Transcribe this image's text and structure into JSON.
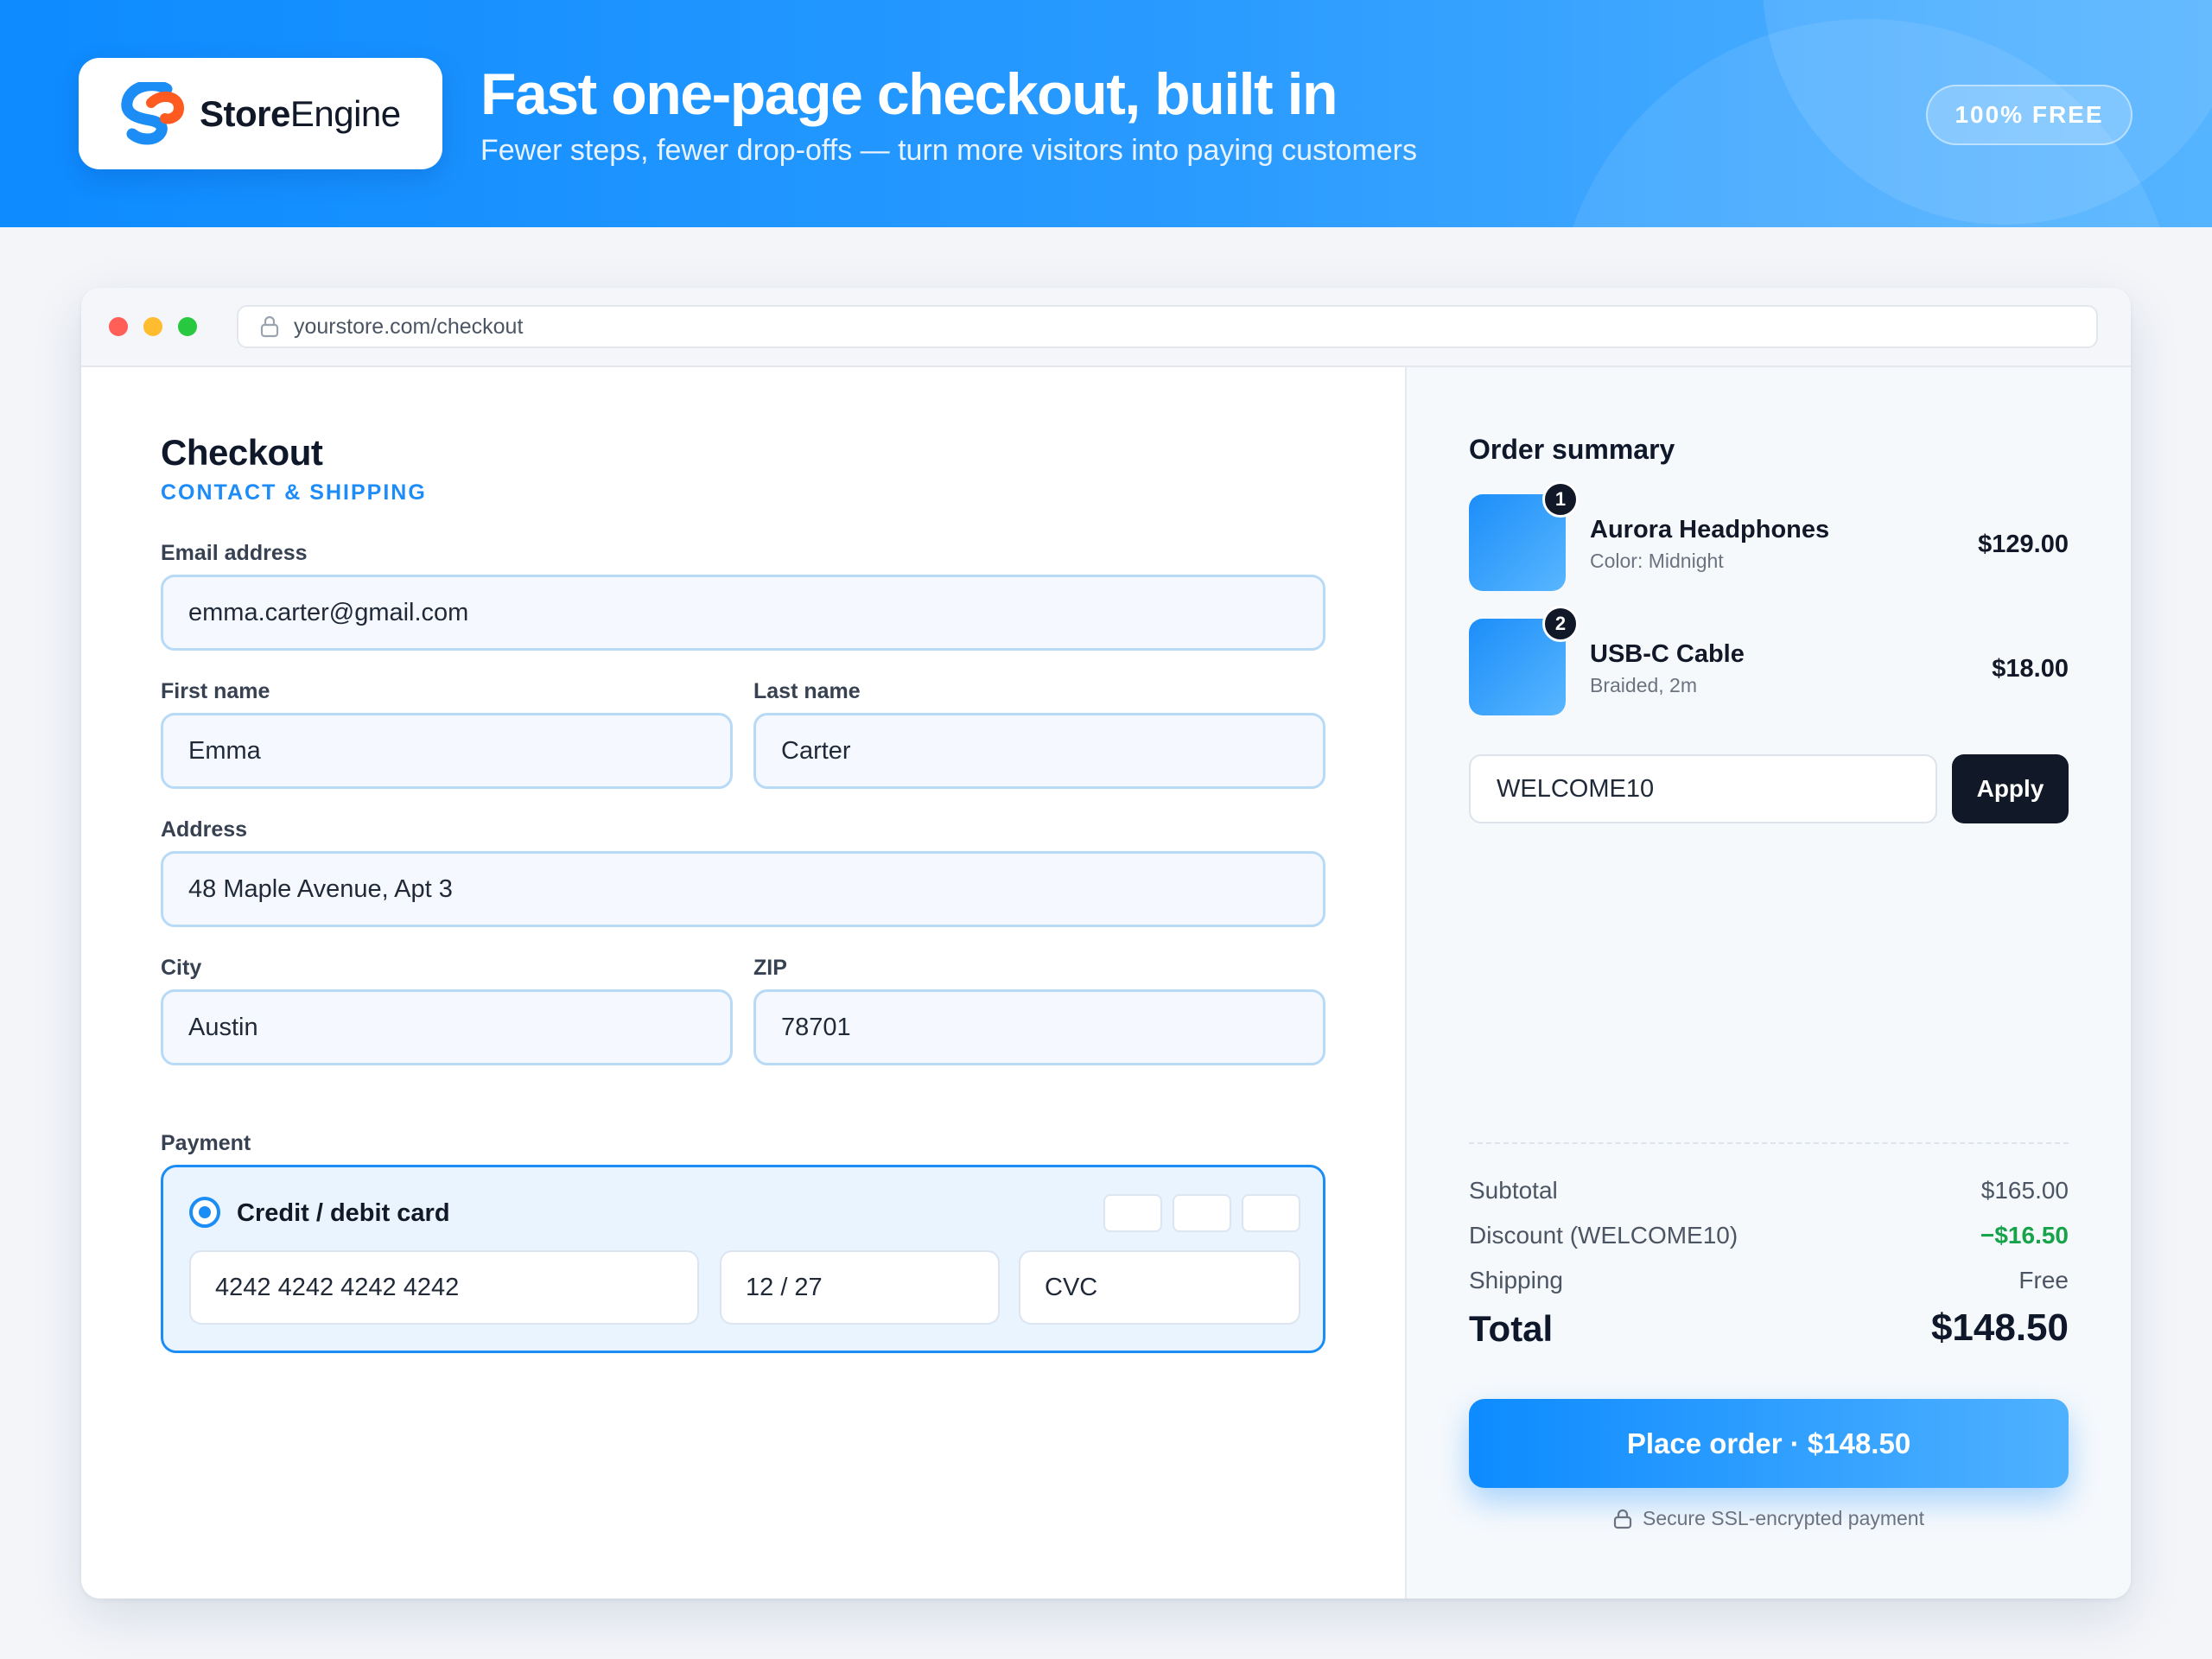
{
  "brand": {
    "name_strong": "Store",
    "name_light": "Engine",
    "primary_color": "#0d8bff"
  },
  "banner": {
    "headline": "Fast one-page checkout, built in",
    "subheadline": "Fewer steps, fewer drop-offs — turn more visitors into paying customers",
    "badge": "100% FREE"
  },
  "browser": {
    "url": "yourstore.com/checkout"
  },
  "checkout": {
    "title": "Checkout",
    "section": "CONTACT & SHIPPING",
    "fields": {
      "email": {
        "label": "Email address",
        "value": "emma.carter@gmail.com"
      },
      "first_name": {
        "label": "First name",
        "value": "Emma"
      },
      "last_name": {
        "label": "Last name",
        "value": "Carter"
      },
      "address": {
        "label": "Address",
        "value": "48 Maple Avenue, Apt 3"
      },
      "city": {
        "label": "City",
        "value": "Austin"
      },
      "zip": {
        "label": "ZIP",
        "value": "78701"
      }
    },
    "payment": {
      "label": "Payment",
      "method": "Credit / debit card",
      "card_number": "4242 4242 4242 4242",
      "expiry": "12 / 27",
      "cvc_placeholder": "CVC"
    }
  },
  "order_summary": {
    "title": "Order summary",
    "items": [
      {
        "qty": "1",
        "name": "Aurora Headphones",
        "variant": "Color: Midnight",
        "price": "$129.00"
      },
      {
        "qty": "2",
        "name": "USB-C Cable",
        "variant": "Braided, 2m",
        "price": "$18.00"
      }
    ],
    "coupon": {
      "value": "WELCOME10",
      "apply_label": "Apply"
    },
    "subtotal": {
      "label": "Subtotal",
      "value": "$165.00"
    },
    "discount": {
      "label": "Discount (WELCOME10)",
      "value": "−$16.50",
      "color": "#16a34a"
    },
    "shipping": {
      "label": "Shipping",
      "value": "Free"
    },
    "total": {
      "label": "Total",
      "value": "$148.50"
    },
    "place_order_label": "Place order · $148.50",
    "secure_note": "Secure SSL-encrypted payment"
  }
}
